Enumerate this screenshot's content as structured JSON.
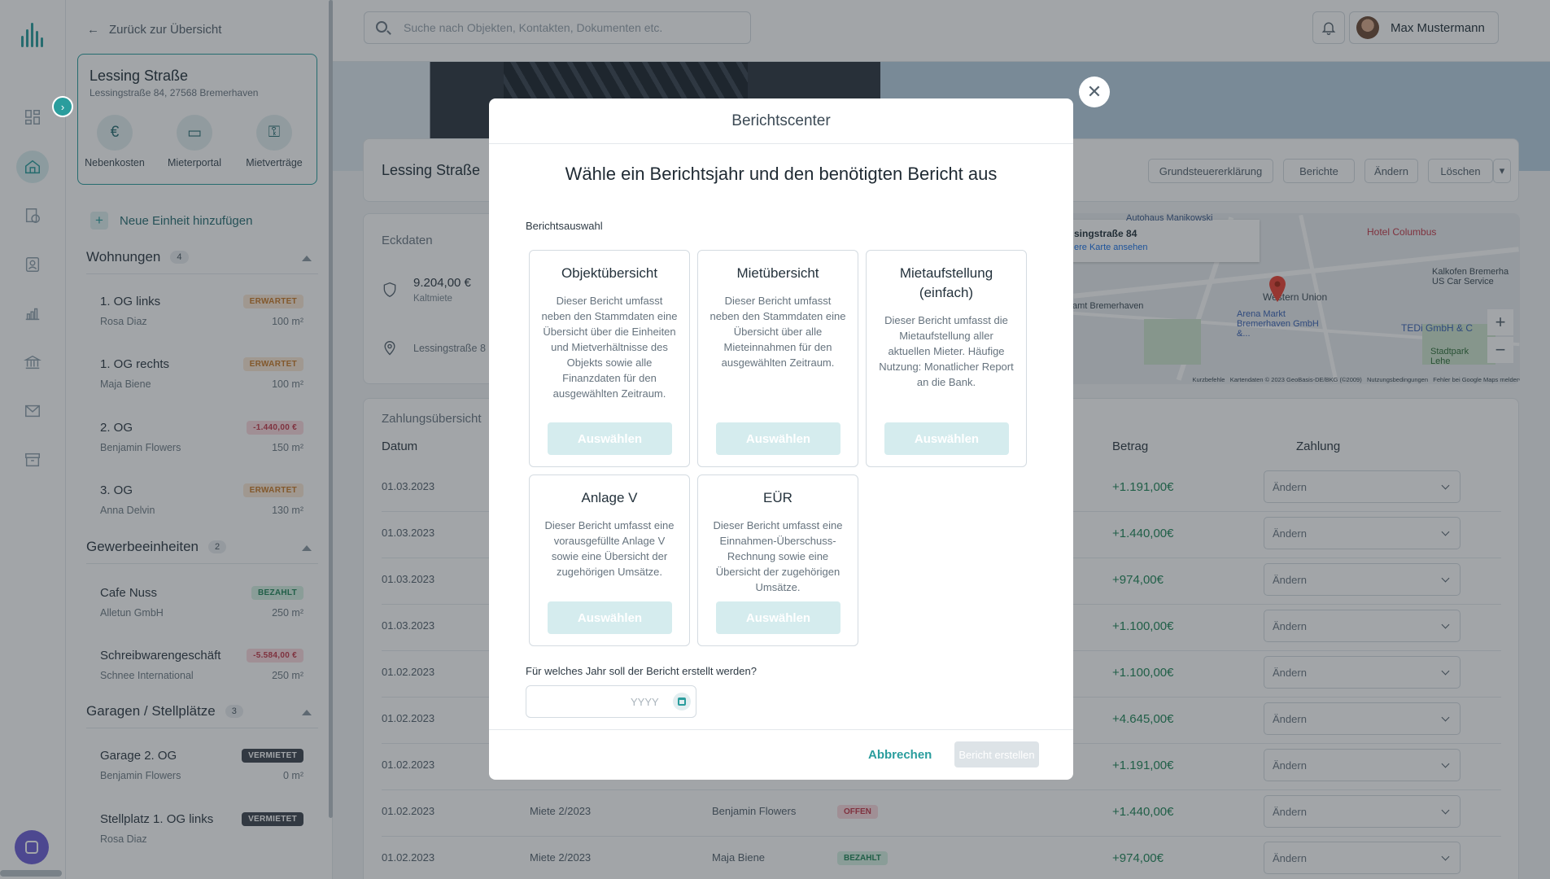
{
  "colors": {
    "accent": "#2a9d9d",
    "positive": "#22875a",
    "warning": "#c97b2a",
    "negative": "#c33a4a"
  },
  "sidebar": {
    "back_label": "Zurück zur Übersicht",
    "object": {
      "name": "Lessing Straße",
      "address": "Lessingstraße 84, 27568 Bremerhaven",
      "actions": [
        {
          "label": "Nebenkosten",
          "icon": "utility-costs-icon"
        },
        {
          "label": "Mieterportal",
          "icon": "tenant-portal-icon"
        },
        {
          "label": "Mietverträge",
          "icon": "rental-contracts-icon"
        }
      ]
    },
    "add_unit_label": "Neue Einheit hinzufügen",
    "sections": [
      {
        "title": "Wohnungen",
        "count": "4",
        "units": [
          {
            "name": "1. OG links",
            "tenant": "Rosa Diaz",
            "size": "100 m²",
            "badge": "ERWARTET",
            "badge_type": "erw"
          },
          {
            "name": "1. OG rechts",
            "tenant": "Maja Biene",
            "size": "100 m²",
            "badge": "ERWARTET",
            "badge_type": "erw"
          },
          {
            "name": "2. OG",
            "tenant": "Benjamin Flowers",
            "size": "150 m²",
            "badge": "-1.440,00 €",
            "badge_type": "neg"
          },
          {
            "name": "3. OG",
            "tenant": "Anna Delvin",
            "size": "130 m²",
            "badge": "ERWARTET",
            "badge_type": "erw"
          }
        ]
      },
      {
        "title": "Gewerbeeinheiten",
        "count": "2",
        "units": [
          {
            "name": "Cafe Nuss",
            "tenant": "Alletun GmbH",
            "size": "250 m²",
            "badge": "BEZAHLT",
            "badge_type": "bez"
          },
          {
            "name": "Schreibwarengeschäft",
            "tenant": "Schnee International",
            "size": "250 m²",
            "badge": "-5.584,00 €",
            "badge_type": "neg"
          }
        ]
      },
      {
        "title": "Garagen / Stellplätze",
        "count": "3",
        "units": [
          {
            "name": "Garage 2. OG",
            "tenant": "Benjamin Flowers",
            "size": "0 m²",
            "badge": "VERMIETET",
            "badge_type": "ver"
          },
          {
            "name": "Stellplatz 1. OG links",
            "tenant": "Rosa Diaz",
            "size": "",
            "badge": "VERMIETET",
            "badge_type": "ver"
          }
        ]
      }
    ]
  },
  "topbar": {
    "search_placeholder": "Suche nach Objekten, Kontakten, Dokumenten etc.",
    "user_name": "Max Mustermann"
  },
  "main": {
    "object_title": "Lessing Straße",
    "header_buttons": [
      "Grundsteuererklärung",
      "Berichte",
      "Ändern",
      "Löschen"
    ],
    "eckdaten": {
      "label": "Eckdaten",
      "rent_value": "9.204,00 €",
      "rent_label": "Kaltmiete",
      "address": "Lessingstraße 8"
    },
    "map": {
      "card_title": "singstraße 84",
      "card_link": "ere Karte ansehen",
      "labels": [
        "Autohaus Manikowski",
        "Hotel Columbus",
        "Western Union",
        "Arena Markt Bremerhaven GmbH &...",
        "TEDi GmbH & C",
        "Kalkofen Bremerha US Car Service",
        "Stadtpark Lehe",
        "amt Bremerhaven"
      ],
      "footer": "Kurzbefehle   Kartendaten © 2023 GeoBasis-DE/BKG (©2009)   Nutzungsbedingungen   Fehler bei Google Maps melden"
    },
    "payments": {
      "label": "Zahlungsübersicht",
      "columns": {
        "date": "Datum",
        "amount": "Betrag",
        "payment": "Zahlung"
      },
      "rows": [
        {
          "date": "01.03.2023",
          "desc": "",
          "tenant": "",
          "status": "",
          "amount": "+1.191,00€",
          "action": "Ändern"
        },
        {
          "date": "01.03.2023",
          "desc": "",
          "tenant": "",
          "status": "",
          "amount": "+1.440,00€",
          "action": "Ändern"
        },
        {
          "date": "01.03.2023",
          "desc": "",
          "tenant": "",
          "status": "",
          "amount": "+974,00€",
          "action": "Ändern"
        },
        {
          "date": "01.03.2023",
          "desc": "",
          "tenant": "",
          "status": "",
          "amount": "+1.100,00€",
          "action": "Ändern"
        },
        {
          "date": "01.02.2023",
          "desc": "",
          "tenant": "",
          "status": "",
          "amount": "+1.100,00€",
          "action": "Ändern"
        },
        {
          "date": "01.02.2023",
          "desc": "",
          "tenant": "",
          "status": "",
          "amount": "+4.645,00€",
          "action": "Ändern"
        },
        {
          "date": "01.02.2023",
          "desc": "",
          "tenant": "",
          "status": "",
          "amount": "+1.191,00€",
          "action": "Ändern"
        },
        {
          "date": "01.02.2023",
          "desc": "Miete 2/2023",
          "tenant": "Benjamin Flowers",
          "status": "OFFEN",
          "amount": "+1.440,00€",
          "action": "Ändern"
        },
        {
          "date": "01.02.2023",
          "desc": "Miete 2/2023",
          "tenant": "Maja Biene",
          "status": "BEZAHLT",
          "amount": "+974,00€",
          "action": "Ändern"
        }
      ]
    }
  },
  "modal": {
    "title": "Berichtscenter",
    "headline": "Wähle ein Berichtsjahr und den benötigten Bericht aus",
    "section_label": "Berichtsauswahl",
    "reports": [
      {
        "title": "Objektübersicht",
        "description": "Dieser Bericht umfasst neben den Stammdaten eine Übersicht über die Einheiten und Mietverhältnisse des Objekts sowie alle Finanzdaten für den ausgewählten Zeitraum.",
        "button": "Auswählen"
      },
      {
        "title": "Mietübersicht",
        "description": "Dieser Bericht umfasst neben den Stammdaten eine Übersicht über alle Mieteinnahmen für den ausgewählten Zeitraum.",
        "button": "Auswählen"
      },
      {
        "title": "Mietaufstellung (einfach)",
        "description": "Dieser Bericht umfasst die Mietaufstellung aller aktuellen Mieter. Häufige Nutzung: Monatlicher Report an die Bank.",
        "button": "Auswählen"
      },
      {
        "title": "Anlage V",
        "description": "Dieser Bericht umfasst eine vorausgefüllte Anlage V sowie eine Übersicht der zugehörigen Umsätze.",
        "button": "Auswählen"
      },
      {
        "title": "EÜR",
        "description": "Dieser Bericht umfasst eine Einnahmen-Überschuss-Rechnung sowie eine Übersicht der zugehörigen Umsätze.",
        "button": "Auswählen"
      }
    ],
    "year_question": "Für welches Jahr soll der Bericht erstellt werden?",
    "year_placeholder": "YYYY",
    "cancel_label": "Abbrechen",
    "create_label": "Bericht erstellen"
  }
}
